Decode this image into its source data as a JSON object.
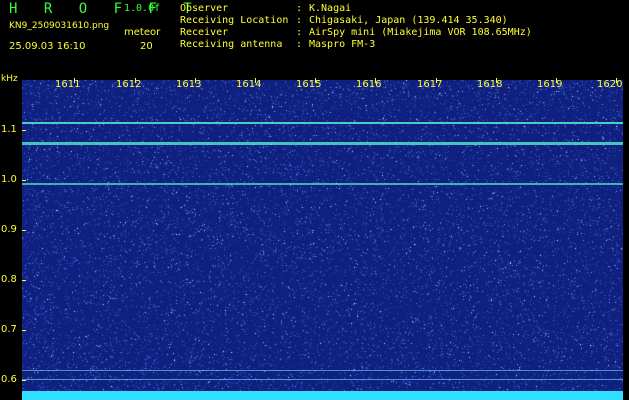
{
  "header": {
    "app_title": "H R O F F T",
    "version": "1.0.0f",
    "file_name": "KN9_2509031610.png",
    "datetime": "25.09.03 16:10",
    "meteor_label": "meteor",
    "meteor_count": "20",
    "info": [
      {
        "key": "Observer",
        "value": "K.Nagai"
      },
      {
        "key": "Receiving Location",
        "value": "Chigasaki, Japan (139.414 35.340)"
      },
      {
        "key": "Receiver",
        "value": "AirSpy mini (Miakejima VOR 108.65MHz)"
      },
      {
        "key": "Receiving antenna",
        "value": "Maspro FM-3"
      }
    ]
  },
  "spectrogram": {
    "freq_unit": "kHz",
    "time_labels": [
      "1611",
      "1612",
      "1613",
      "1614",
      "1615",
      "1616",
      "1617",
      "1618",
      "1619",
      "1620"
    ],
    "freq_labels": [
      "1.1",
      "1.0",
      "0.9",
      "0.8",
      "0.7",
      "0.6"
    ],
    "colors": {
      "background": "#10207e",
      "noise": "#4a7cff",
      "signal_line": "#4fe0c8",
      "baseband": "#2fe0ff",
      "label": "#ffff33"
    }
  }
}
